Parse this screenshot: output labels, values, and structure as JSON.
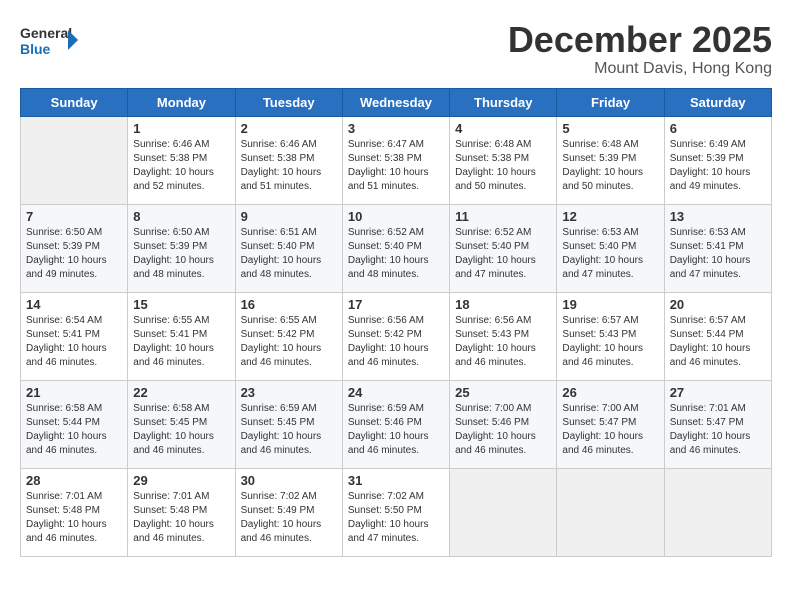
{
  "header": {
    "logo_line1": "General",
    "logo_line2": "Blue",
    "month": "December 2025",
    "location": "Mount Davis, Hong Kong"
  },
  "days_of_week": [
    "Sunday",
    "Monday",
    "Tuesday",
    "Wednesday",
    "Thursday",
    "Friday",
    "Saturday"
  ],
  "weeks": [
    [
      {
        "day": "",
        "info": ""
      },
      {
        "day": "1",
        "info": "Sunrise: 6:46 AM\nSunset: 5:38 PM\nDaylight: 10 hours\nand 52 minutes."
      },
      {
        "day": "2",
        "info": "Sunrise: 6:46 AM\nSunset: 5:38 PM\nDaylight: 10 hours\nand 51 minutes."
      },
      {
        "day": "3",
        "info": "Sunrise: 6:47 AM\nSunset: 5:38 PM\nDaylight: 10 hours\nand 51 minutes."
      },
      {
        "day": "4",
        "info": "Sunrise: 6:48 AM\nSunset: 5:38 PM\nDaylight: 10 hours\nand 50 minutes."
      },
      {
        "day": "5",
        "info": "Sunrise: 6:48 AM\nSunset: 5:39 PM\nDaylight: 10 hours\nand 50 minutes."
      },
      {
        "day": "6",
        "info": "Sunrise: 6:49 AM\nSunset: 5:39 PM\nDaylight: 10 hours\nand 49 minutes."
      }
    ],
    [
      {
        "day": "7",
        "info": "Sunrise: 6:50 AM\nSunset: 5:39 PM\nDaylight: 10 hours\nand 49 minutes."
      },
      {
        "day": "8",
        "info": "Sunrise: 6:50 AM\nSunset: 5:39 PM\nDaylight: 10 hours\nand 48 minutes."
      },
      {
        "day": "9",
        "info": "Sunrise: 6:51 AM\nSunset: 5:40 PM\nDaylight: 10 hours\nand 48 minutes."
      },
      {
        "day": "10",
        "info": "Sunrise: 6:52 AM\nSunset: 5:40 PM\nDaylight: 10 hours\nand 48 minutes."
      },
      {
        "day": "11",
        "info": "Sunrise: 6:52 AM\nSunset: 5:40 PM\nDaylight: 10 hours\nand 47 minutes."
      },
      {
        "day": "12",
        "info": "Sunrise: 6:53 AM\nSunset: 5:40 PM\nDaylight: 10 hours\nand 47 minutes."
      },
      {
        "day": "13",
        "info": "Sunrise: 6:53 AM\nSunset: 5:41 PM\nDaylight: 10 hours\nand 47 minutes."
      }
    ],
    [
      {
        "day": "14",
        "info": "Sunrise: 6:54 AM\nSunset: 5:41 PM\nDaylight: 10 hours\nand 46 minutes."
      },
      {
        "day": "15",
        "info": "Sunrise: 6:55 AM\nSunset: 5:41 PM\nDaylight: 10 hours\nand 46 minutes."
      },
      {
        "day": "16",
        "info": "Sunrise: 6:55 AM\nSunset: 5:42 PM\nDaylight: 10 hours\nand 46 minutes."
      },
      {
        "day": "17",
        "info": "Sunrise: 6:56 AM\nSunset: 5:42 PM\nDaylight: 10 hours\nand 46 minutes."
      },
      {
        "day": "18",
        "info": "Sunrise: 6:56 AM\nSunset: 5:43 PM\nDaylight: 10 hours\nand 46 minutes."
      },
      {
        "day": "19",
        "info": "Sunrise: 6:57 AM\nSunset: 5:43 PM\nDaylight: 10 hours\nand 46 minutes."
      },
      {
        "day": "20",
        "info": "Sunrise: 6:57 AM\nSunset: 5:44 PM\nDaylight: 10 hours\nand 46 minutes."
      }
    ],
    [
      {
        "day": "21",
        "info": "Sunrise: 6:58 AM\nSunset: 5:44 PM\nDaylight: 10 hours\nand 46 minutes."
      },
      {
        "day": "22",
        "info": "Sunrise: 6:58 AM\nSunset: 5:45 PM\nDaylight: 10 hours\nand 46 minutes."
      },
      {
        "day": "23",
        "info": "Sunrise: 6:59 AM\nSunset: 5:45 PM\nDaylight: 10 hours\nand 46 minutes."
      },
      {
        "day": "24",
        "info": "Sunrise: 6:59 AM\nSunset: 5:46 PM\nDaylight: 10 hours\nand 46 minutes."
      },
      {
        "day": "25",
        "info": "Sunrise: 7:00 AM\nSunset: 5:46 PM\nDaylight: 10 hours\nand 46 minutes."
      },
      {
        "day": "26",
        "info": "Sunrise: 7:00 AM\nSunset: 5:47 PM\nDaylight: 10 hours\nand 46 minutes."
      },
      {
        "day": "27",
        "info": "Sunrise: 7:01 AM\nSunset: 5:47 PM\nDaylight: 10 hours\nand 46 minutes."
      }
    ],
    [
      {
        "day": "28",
        "info": "Sunrise: 7:01 AM\nSunset: 5:48 PM\nDaylight: 10 hours\nand 46 minutes."
      },
      {
        "day": "29",
        "info": "Sunrise: 7:01 AM\nSunset: 5:48 PM\nDaylight: 10 hours\nand 46 minutes."
      },
      {
        "day": "30",
        "info": "Sunrise: 7:02 AM\nSunset: 5:49 PM\nDaylight: 10 hours\nand 46 minutes."
      },
      {
        "day": "31",
        "info": "Sunrise: 7:02 AM\nSunset: 5:50 PM\nDaylight: 10 hours\nand 47 minutes."
      },
      {
        "day": "",
        "info": ""
      },
      {
        "day": "",
        "info": ""
      },
      {
        "day": "",
        "info": ""
      }
    ]
  ]
}
